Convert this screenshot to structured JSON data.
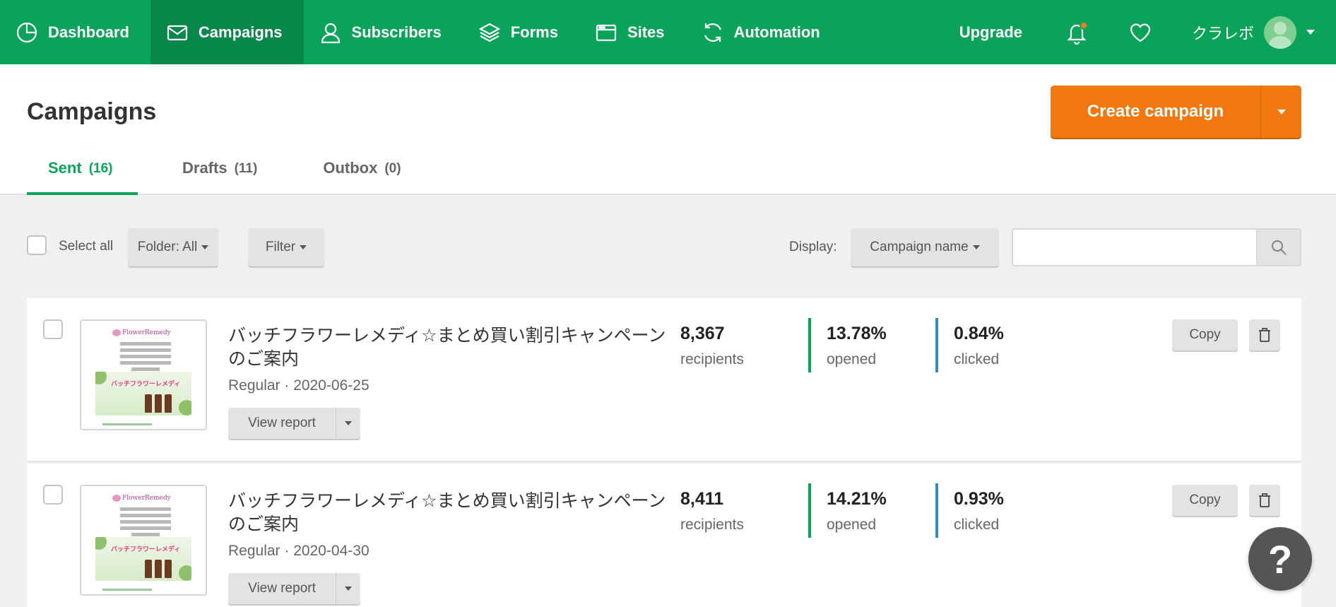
{
  "nav": {
    "items": [
      {
        "label": "Dashboard",
        "icon": "clock-icon"
      },
      {
        "label": "Campaigns",
        "icon": "envelope-icon"
      },
      {
        "label": "Subscribers",
        "icon": "user-icon"
      },
      {
        "label": "Forms",
        "icon": "layers-icon"
      },
      {
        "label": "Sites",
        "icon": "browser-window-icon"
      },
      {
        "label": "Automation",
        "icon": "refresh-icon"
      }
    ],
    "active": "Campaigns",
    "upgrade_label": "Upgrade",
    "user_name": "クラレボ"
  },
  "header": {
    "title": "Campaigns",
    "create_label": "Create campaign",
    "tabs": [
      {
        "label": "Sent",
        "count": "(16)",
        "active": true
      },
      {
        "label": "Drafts",
        "count": "(11)",
        "active": false
      },
      {
        "label": "Outbox",
        "count": "(0)",
        "active": false
      }
    ]
  },
  "toolbar": {
    "select_all_label": "Select all",
    "folder_label": "Folder: All",
    "filter_label": "Filter",
    "display_label": "Display:",
    "display_value": "Campaign name",
    "search_value": ""
  },
  "campaigns": [
    {
      "title": "バッチフラワーレメディ☆まとめ買い割引キャンペーンのご案内",
      "meta": "Regular · 2020-06-25",
      "view_label": "View report",
      "recipients": "8,367",
      "recipients_label": "recipients",
      "opened": "13.78%",
      "opened_label": "opened",
      "clicked": "0.84%",
      "clicked_label": "clicked",
      "copy_label": "Copy"
    },
    {
      "title": "バッチフラワーレメディ☆まとめ買い割引キャンペーンのご案内",
      "meta": "Regular · 2020-04-30",
      "view_label": "View report",
      "recipients": "8,411",
      "recipients_label": "recipients",
      "opened": "14.21%",
      "opened_label": "opened",
      "clicked": "0.93%",
      "clicked_label": "clicked",
      "copy_label": "Copy"
    }
  ],
  "thumbnail": {
    "logo_text": "FlowerRemedy",
    "banner_text": "バッチフラワーレメディ"
  },
  "help_label": "?",
  "colors": {
    "nav_green": "#09a45a",
    "nav_active": "#07884a",
    "accent_orange": "#f0780f",
    "opened_bar": "#09a45a",
    "clicked_bar": "#2f8ccb"
  }
}
